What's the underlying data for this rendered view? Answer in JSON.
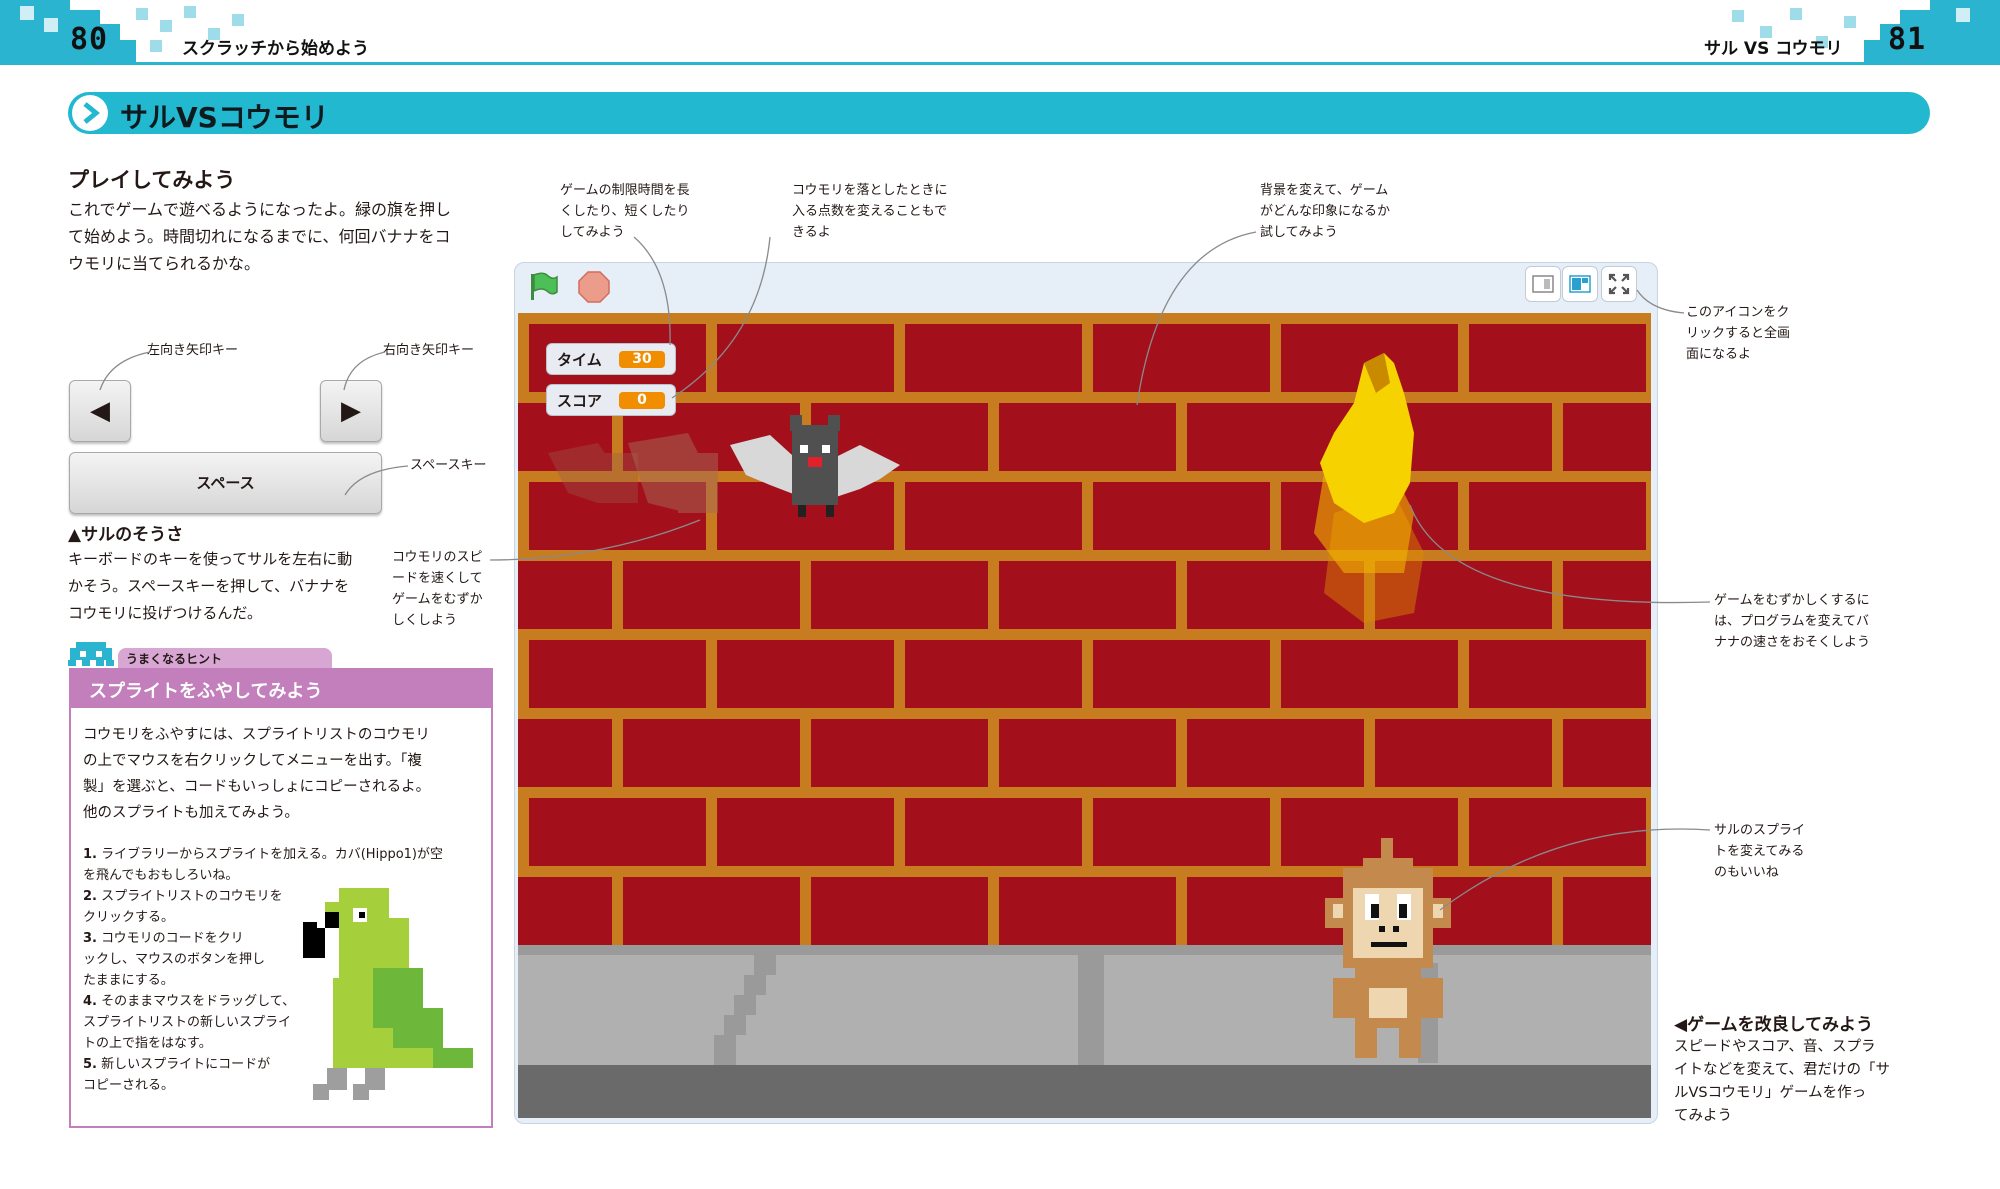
{
  "header": {
    "left_page_number": "80",
    "left_running_title": "スクラッチから始めよう",
    "right_running_title": "サル VS コウモリ",
    "right_page_number": "81"
  },
  "banner": {
    "title": "サルVSコウモリ",
    "icon": "chevron-right-icon"
  },
  "play": {
    "heading": "プレイしてみよう",
    "body_lines": [
      "これでゲームで遊べるようになったよ。緑の旗を押し",
      "て始めよう。時間切れになるまでに、何回バナナをコ",
      "ウモリに当てられるかな。"
    ]
  },
  "keys": {
    "left_label": "左向き矢印キー",
    "right_label": "右向き矢印キー",
    "left_key": "◀",
    "right_key": "▶",
    "space_key": "スペース",
    "space_label": "スペースキー"
  },
  "controls": {
    "heading": "▲サルのそうさ",
    "body_lines": [
      "キーボードのキーを使ってサルを左右に動",
      "かそう。スペースキーを押して、バナナを",
      "コウモリに投げつけるんだ。"
    ]
  },
  "hint": {
    "tab_label": "うまくなるヒント",
    "title": "スプライトをふやしてみよう",
    "intro_lines": [
      "コウモリをふやすには、スプライトリストのコウモリ",
      "の上でマウスを右クリックしてメニューを出す。「複",
      "製」を選ぶと、コードもいっしょにコピーされるよ。",
      "他のスプライトも加えてみよう。"
    ],
    "steps": [
      {
        "num": "1.",
        "lines": [
          "ライブラリーからスプライトを加える。カバ(Hippo1)が空",
          "を飛んでもおもしろいね。"
        ]
      },
      {
        "num": "2.",
        "lines": [
          "スプライトリストのコウモリを",
          "クリックする。"
        ]
      },
      {
        "num": "3.",
        "lines": [
          "コウモリのコードをクリ",
          "ックし、マウスのボタンを押し",
          "たままにする。"
        ]
      },
      {
        "num": "4.",
        "lines": [
          "そのままマウスをドラッグして、",
          "スプライトリストの新しいスプライ",
          "トの上で指をはなす。"
        ]
      },
      {
        "num": "5.",
        "lines": [
          "新しいスプライトにコードが",
          "コピーされる。"
        ]
      }
    ]
  },
  "callouts": {
    "timer": [
      "ゲームの制限時間を長",
      "くしたり、短くしたり",
      "してみよう"
    ],
    "points": [
      "コウモリを落としたときに",
      "入る点数を変えることもで",
      "きるよ"
    ],
    "backdrop": [
      "背景を変えて、ゲーム",
      "がどんな印象になるか",
      "試してみよう"
    ],
    "fullscreen": [
      "このアイコンをク",
      "リックすると全画",
      "面になるよ"
    ],
    "bat_speed": [
      "コウモリのスピ",
      "ードを速くして",
      "ゲームをむずか",
      "しくしよう"
    ],
    "banana_speed": [
      "ゲームをむずかしくするに",
      "は、プログラムを変えてバ",
      "ナナの速さをおそくしよう"
    ],
    "monkey_sprite": [
      "サルのスプライ",
      "トを変えてみる",
      "のもいいね"
    ]
  },
  "improve": {
    "heading": "◀ゲームを改良してみよう",
    "body_lines": [
      "スピードやスコア、音、スプラ",
      "イトなどを変えて、君だけの「サ",
      "ルVSコウモリ」ゲームを作っ",
      "てみよう"
    ]
  },
  "stage": {
    "green_flag": "green-flag-icon",
    "stop": "stop-icon",
    "timer_label": "タイム",
    "timer_value": "30",
    "score_label": "スコア",
    "score_value": "0",
    "colors": {
      "brick": "#a3101c",
      "mortar": "#c77c1f",
      "sidewalk": "#b0b0b0",
      "road": "#6a6a6a",
      "accent": "#22b8d0"
    }
  }
}
